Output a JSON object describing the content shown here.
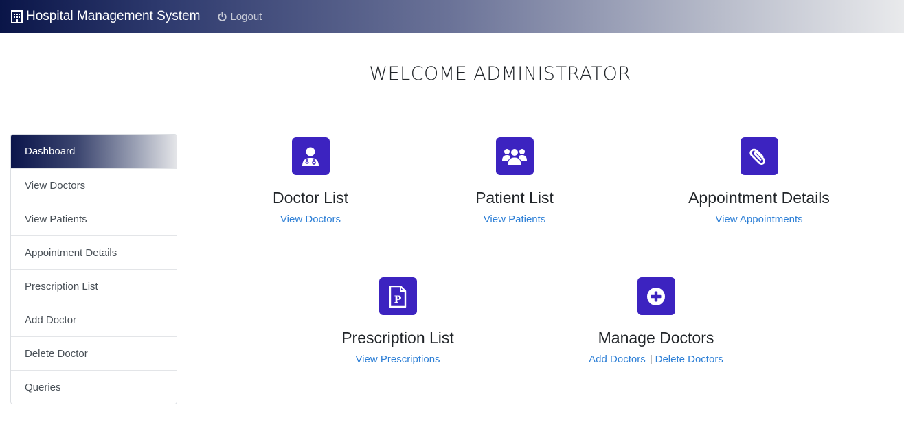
{
  "navbar": {
    "brand_icon": "hospital-icon",
    "brand": "Hospital Management System",
    "logout_icon": "power-icon",
    "logout": "Logout"
  },
  "welcome": "WELCOME ADMINISTRATOR",
  "sidebar": {
    "items": [
      {
        "label": "Dashboard",
        "active": true
      },
      {
        "label": "View Doctors"
      },
      {
        "label": "View Patients"
      },
      {
        "label": "Appointment Details"
      },
      {
        "label": "Prescription List"
      },
      {
        "label": "Add Doctor"
      },
      {
        "label": "Delete Doctor"
      },
      {
        "label": "Queries"
      }
    ]
  },
  "cards": {
    "doctor": {
      "icon": "doctor-icon",
      "title": "Doctor List",
      "link": "View Doctors"
    },
    "patient": {
      "icon": "users-icon",
      "title": "Patient List",
      "link": "View Patients"
    },
    "appointment": {
      "icon": "paperclip-icon",
      "title": "Appointment Details",
      "link": "View Appointments"
    },
    "prescription": {
      "icon": "prescription-icon",
      "title": "Prescription List",
      "link": "View Prescriptions"
    },
    "manage": {
      "icon": "plus-circle-icon",
      "title": "Manage Doctors",
      "link_add": "Add Doctors",
      "separator": "|",
      "link_delete": "Delete Doctors"
    }
  },
  "colors": {
    "accent": "#3c23c0",
    "link": "#2f80d6",
    "navbar_dark": "#0a1548"
  }
}
